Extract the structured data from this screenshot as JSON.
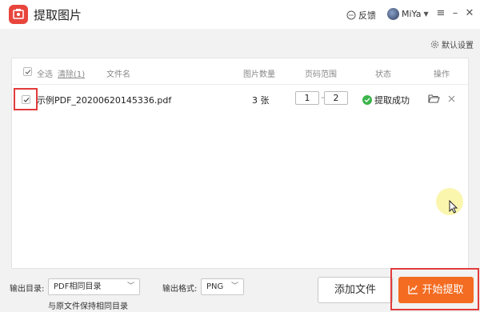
{
  "app": {
    "title": "提取图片"
  },
  "header": {
    "feedback": "反馈",
    "username": "MiYa"
  },
  "defaults_label": "默认设置",
  "table": {
    "select_all": "全选",
    "clear": "清除(1)",
    "columns": {
      "filename": "文件名",
      "count": "图片数量",
      "range": "页码范围",
      "status": "状态",
      "action": "操作"
    },
    "rows": [
      {
        "filename": "示例PDF_20200620145336.pdf",
        "count": "3 张",
        "page_from": "1",
        "page_to": "2",
        "status": "提取成功",
        "checked": true
      }
    ]
  },
  "output": {
    "dir_label": "输出目录:",
    "dir_value": "PDF相同目录",
    "dir_hint": "与原文件保持相同目录",
    "format_label": "输出格式:",
    "format_value": "PNG"
  },
  "buttons": {
    "add_file": "添加文件",
    "start": "开始提取"
  },
  "colors": {
    "accent": "#f36c21",
    "logo": "#e8453c",
    "success": "#3ab54a",
    "highlight": "#e23b3b"
  }
}
